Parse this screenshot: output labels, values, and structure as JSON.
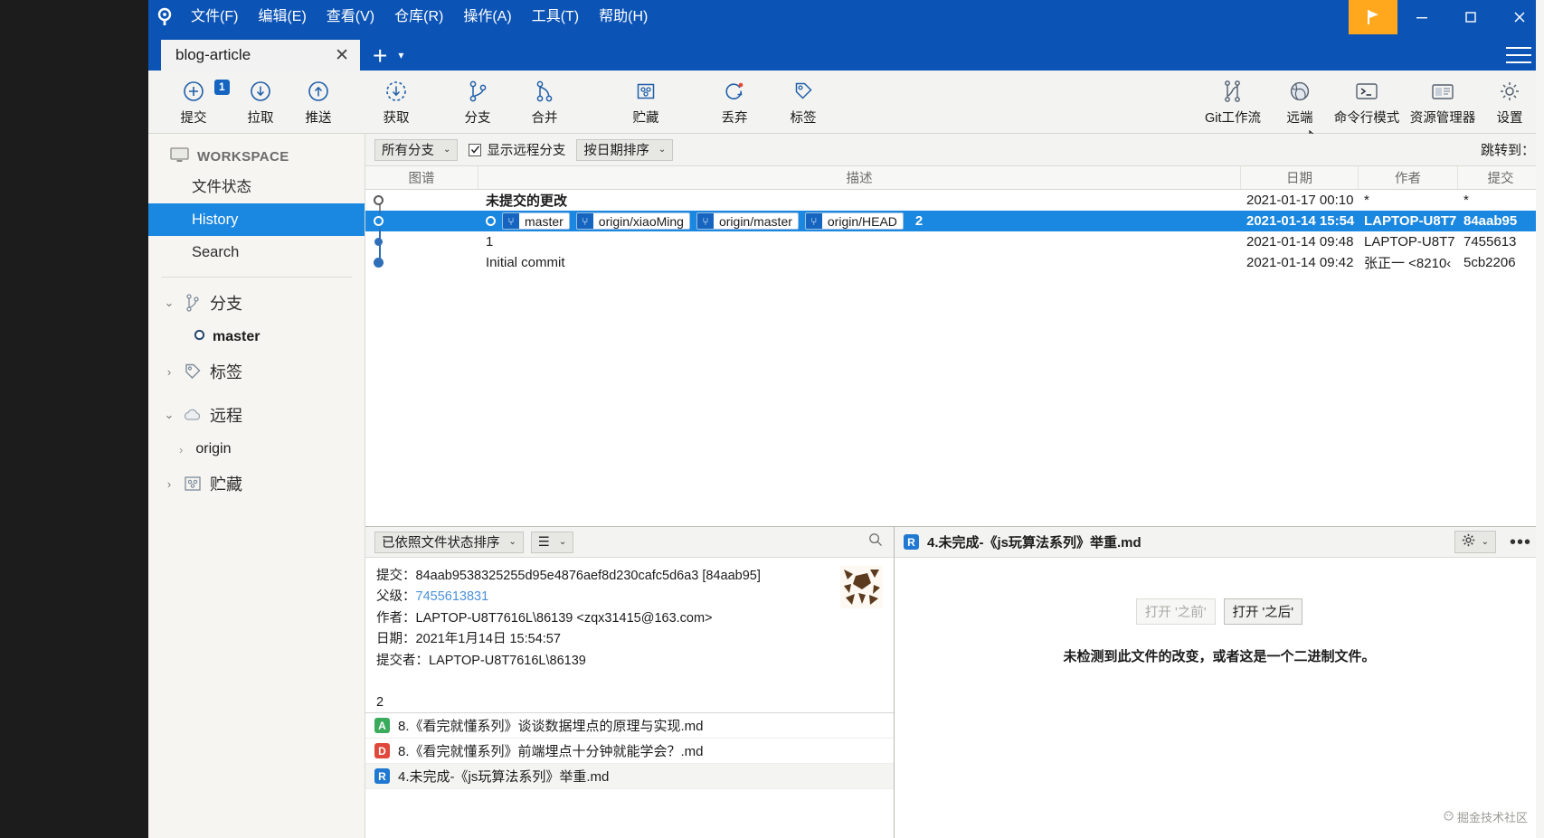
{
  "window": {
    "title": "blog-article",
    "flag_icon": "flag-icon",
    "minimize_icon": "minimize-icon",
    "maximize_icon": "maximize-icon",
    "close_icon": "close-icon",
    "hamburger_icon": "hamburger-menu-icon",
    "app_logo_icon": "sourcetree-logo-icon"
  },
  "menubar": [
    {
      "label": "文件(F)"
    },
    {
      "label": "编辑(E)"
    },
    {
      "label": "查看(V)"
    },
    {
      "label": "仓库(R)"
    },
    {
      "label": "操作(A)"
    },
    {
      "label": "工具(T)"
    },
    {
      "label": "帮助(H)"
    }
  ],
  "tabs": {
    "active": "blog-article",
    "close_label": "✕",
    "add_label": "+",
    "caret_label": "▾"
  },
  "toolbar": {
    "left": [
      {
        "label": "提交",
        "icon": "commit-plus-icon",
        "badge": "1"
      },
      {
        "label": "拉取",
        "icon": "pull-down-arrow-icon",
        "badge": ""
      },
      {
        "label": "推送",
        "icon": "push-up-arrow-icon",
        "badge": ""
      },
      {
        "label": "获取",
        "icon": "fetch-dashed-arrow-icon",
        "badge": ""
      },
      {
        "label": "分支",
        "icon": "branch-icon",
        "badge": ""
      },
      {
        "label": "合并",
        "icon": "merge-icon",
        "badge": ""
      },
      {
        "label": "贮藏",
        "icon": "stash-icon",
        "badge": ""
      },
      {
        "label": "丢弃",
        "icon": "discard-icon",
        "badge": ""
      },
      {
        "label": "标签",
        "icon": "tag-icon",
        "badge": ""
      }
    ],
    "right": [
      {
        "label": "Git工作流",
        "icon": "git-flow-icon"
      },
      {
        "label": "远端",
        "icon": "remote-globe-icon"
      },
      {
        "label": "命令行模式",
        "icon": "terminal-icon"
      },
      {
        "label": "资源管理器",
        "icon": "explorer-icon"
      },
      {
        "label": "设置",
        "icon": "settings-gear-icon"
      }
    ]
  },
  "sidebar": {
    "workspace_label": "WORKSPACE",
    "workspace_icon": "monitor-icon",
    "items": [
      {
        "label": "文件状态",
        "active": false
      },
      {
        "label": "History",
        "active": true
      },
      {
        "label": "Search",
        "active": false
      }
    ],
    "groups": [
      {
        "label": "分支",
        "icon": "branch-icon",
        "expanded": true,
        "twisty": "⌄",
        "children": [
          {
            "label": "master",
            "icon": "branch-node-icon",
            "bold": true
          }
        ]
      },
      {
        "label": "标签",
        "icon": "tag-icon",
        "expanded": false,
        "twisty": "›",
        "children": []
      },
      {
        "label": "远程",
        "icon": "cloud-icon",
        "expanded": true,
        "twisty": "⌄",
        "children": [
          {
            "label": "origin",
            "icon": "",
            "bold": false,
            "twisty": "›"
          }
        ]
      },
      {
        "label": "贮藏",
        "icon": "stash-icon",
        "expanded": false,
        "twisty": "›",
        "children": []
      }
    ]
  },
  "history_bar": {
    "branch_filter": "所有分支",
    "show_remote_label": "显示远程分支",
    "show_remote_checked": true,
    "sort_order": "按日期排序",
    "jump_to_label": "跳转到："
  },
  "commit_table": {
    "columns": [
      "图谱",
      "描述",
      "日期",
      "作者",
      "提交"
    ],
    "rows": [
      {
        "description": "未提交的更改",
        "refs": [],
        "date": "2021-01-17 00:10",
        "author": "*",
        "commit": "*",
        "selected": false,
        "bold": true,
        "node": "hollow"
      },
      {
        "description": "2",
        "refs": [
          "master",
          "origin/xiaoMing",
          "origin/master",
          "origin/HEAD"
        ],
        "date": "2021-01-14 15:54",
        "author": "LAPTOP-U8T7",
        "commit": "84aab95",
        "selected": true,
        "bold": true,
        "node": "sel"
      },
      {
        "description": "1",
        "refs": [],
        "date": "2021-01-14 09:48",
        "author": "LAPTOP-U8T7",
        "commit": "7455613",
        "selected": false,
        "bold": false,
        "node": "fill-small"
      },
      {
        "description": "Initial commit",
        "refs": [],
        "date": "2021-01-14 09:42",
        "author": "张正一 <8210‹",
        "commit": "5cb2206",
        "selected": false,
        "bold": false,
        "node": "fill"
      }
    ]
  },
  "detail_panel": {
    "sort_label": "已依照文件状态排序",
    "view_label": "☰",
    "search_icon": "search-icon",
    "fields": [
      {
        "key": "提交：",
        "value": "84aab9538325255d95e4876aef8d230cafc5d6a3 [84aab95]",
        "link": false
      },
      {
        "key": "父级：",
        "value": "7455613831",
        "link": true
      },
      {
        "key": "作者：",
        "value": "LAPTOP-U8T7616L\\86139 <zqx31415@163.com>",
        "link": false
      },
      {
        "key": "日期：",
        "value": "2021年1月14日 15:54:57",
        "link": false
      },
      {
        "key": "提交者：",
        "value": "LAPTOP-U8T7616L\\86139",
        "link": false
      }
    ],
    "message": "2",
    "avatar_icon": "identicon-avatar"
  },
  "file_list": [
    {
      "status": "A",
      "status_color": "#3aab5c",
      "name": "8.《看完就懂系列》谈谈数据埋点的原理与实现.md",
      "selected": false
    },
    {
      "status": "D",
      "status_color": "#e0483a",
      "name": "8.《看完就懂系列》前端埋点十分钟就能学会？.md",
      "selected": false
    },
    {
      "status": "R",
      "status_color": "#1f78d1",
      "name": "4.未完成-《js玩算法系列》举重.md",
      "selected": true
    }
  ],
  "diff_panel": {
    "file_status": "R",
    "file_status_color": "#1f78d1",
    "file_name": "4.未完成-《js玩算法系列》举重.md",
    "gear_icon": "settings-gear-icon",
    "caret_icon": "chevron-down-icon",
    "more_icon": "more-options-icon",
    "open_before_label": "打开 '之前'",
    "open_after_label": "打开 '之后'",
    "no_change_text": "未检测到此文件的改变，或者这是一个二进制文件。"
  },
  "watermark": {
    "text": "掘金技术社区",
    "icon": "watermark-icon"
  },
  "colors": {
    "title_blue": "#0b53b5",
    "accent_blue": "#1a87e0",
    "flag_orange": "#ffa81d",
    "toolbar_bg": "#f3f3f1",
    "sidebar_bg": "#f7f5f1"
  }
}
